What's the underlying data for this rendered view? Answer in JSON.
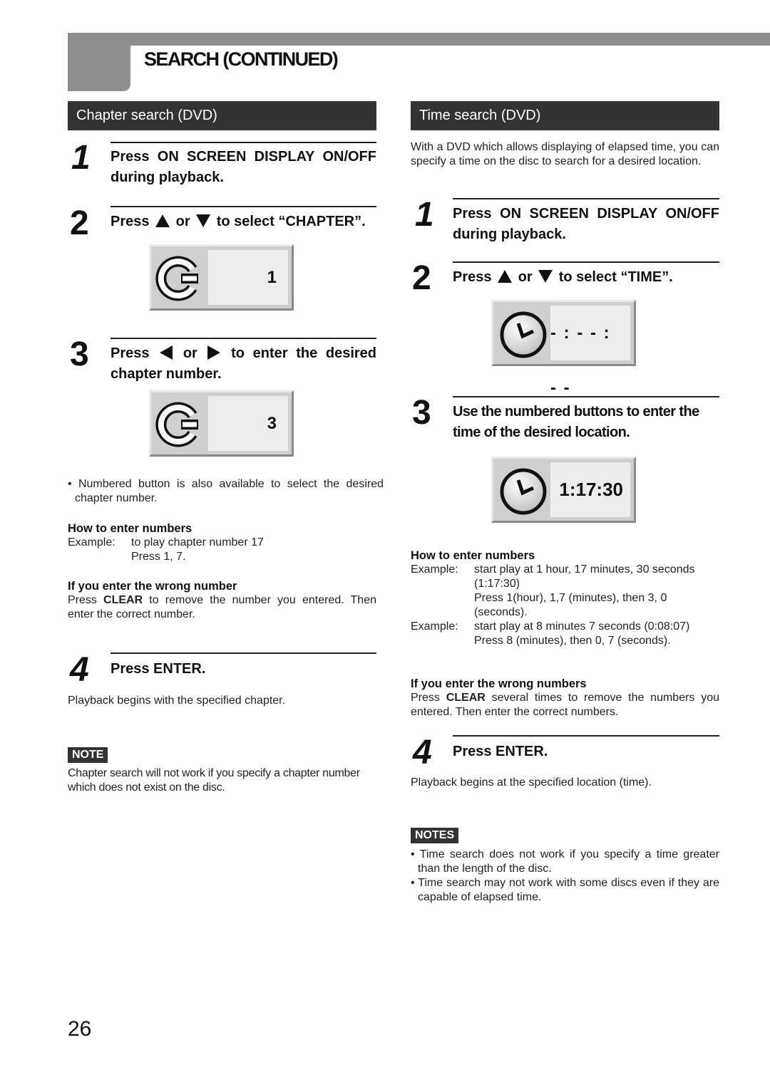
{
  "header": {
    "title": "SEARCH (CONTINUED)"
  },
  "chapter_search": {
    "heading": "Chapter search (DVD)",
    "steps": [
      {
        "number": "1",
        "line1": "Press ON SCREEN DISPLAY ON/OFF",
        "line2": "during playback."
      },
      {
        "number": "2",
        "pre": "Press",
        "mid": "or",
        "post": "to select “CHAPTER”."
      },
      {
        "number": "3",
        "pre": "Press",
        "mid": "or",
        "post": "to enter the desired",
        "line2": "chapter number."
      },
      {
        "number": "4",
        "text": "Press ENTER."
      }
    ],
    "osd_step2": {
      "icon": "chapter-icon",
      "value": "1"
    },
    "osd_step3": {
      "icon": "chapter-icon",
      "value": "3"
    },
    "bullet": "• Numbered button is also available to select the desired chapter number.",
    "how_to": {
      "heading": "How to enter numbers",
      "example_label": "Example:",
      "example_line1": "to play chapter number 17",
      "example_line2": "Press 1, 7."
    },
    "wrong": {
      "heading": "If you enter the wrong number",
      "pre": "Press",
      "key": "CLEAR",
      "post": "to remove the number you entered. Then enter the correct number."
    },
    "result": "Playback begins with the specified chapter.",
    "note": {
      "badge": "NOTE",
      "text": "Chapter search will not work if you specify a chapter number which does not exist on the disc."
    }
  },
  "time_search": {
    "heading": "Time search (DVD)",
    "intro": "With a DVD which allows displaying of elapsed time, you can specify a time on the disc to search for a desired location.",
    "steps": [
      {
        "number": "1",
        "line1": "Press ON SCREEN DISPLAY ON/OFF",
        "line2": "during playback."
      },
      {
        "number": "2",
        "pre": "Press",
        "mid": "or",
        "post": "to select “TIME”."
      },
      {
        "number": "3",
        "line1": "Use the numbered buttons to enter the",
        "line2": "time of the desired location."
      },
      {
        "number": "4",
        "text": "Press ENTER."
      }
    ],
    "osd_step2": {
      "icon": "clock-icon",
      "value": "- : - - : - -"
    },
    "osd_step3": {
      "icon": "clock-icon",
      "value": "1:17:30"
    },
    "how_to": {
      "heading": "How to enter numbers",
      "examples": [
        {
          "label": "Example:",
          "lines": [
            "start play at 1 hour, 17 minutes, 30 seconds",
            "(1:17:30)",
            "Press 1(hour), 1,7 (minutes), then 3, 0",
            "(seconds)."
          ]
        },
        {
          "label": "Example:",
          "lines": [
            "start play at 8 minutes 7 seconds (0:08:07)",
            "Press 8 (minutes), then 0, 7 (seconds)."
          ]
        }
      ]
    },
    "wrong": {
      "heading": "If you enter the wrong numbers",
      "pre": "Press",
      "key": "CLEAR",
      "post": "several times to remove the numbers you entered.  Then enter the correct numbers."
    },
    "result": "Playback begins at the specified location (time).",
    "notes": {
      "badge": "NOTES",
      "items": [
        "• Time search does not work if you specify a time greater than the length of the disc.",
        "• Time search may not work with some discs even if they are capable of elapsed time."
      ]
    }
  },
  "page_number": "26"
}
